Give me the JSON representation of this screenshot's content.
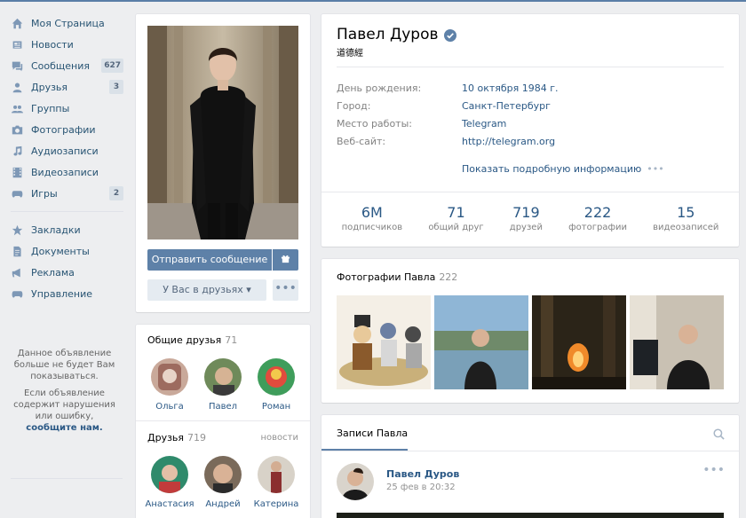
{
  "nav": {
    "items": [
      {
        "label": "Моя Страница",
        "icon": "home-icon"
      },
      {
        "label": "Новости",
        "icon": "news-icon"
      },
      {
        "label": "Сообщения",
        "icon": "messages-icon",
        "count": "627"
      },
      {
        "label": "Друзья",
        "icon": "friends-icon",
        "count": "3"
      },
      {
        "label": "Группы",
        "icon": "groups-icon"
      },
      {
        "label": "Фотографии",
        "icon": "camera-icon"
      },
      {
        "label": "Аудиозаписи",
        "icon": "music-note-icon"
      },
      {
        "label": "Видеозаписи",
        "icon": "film-icon"
      },
      {
        "label": "Игры",
        "icon": "gamepad-icon",
        "count": "2"
      }
    ],
    "extra": [
      {
        "label": "Закладки",
        "icon": "star-icon"
      },
      {
        "label": "Документы",
        "icon": "document-icon"
      },
      {
        "label": "Реклама",
        "icon": "megaphone-icon"
      },
      {
        "label": "Управление",
        "icon": "gamepad-icon"
      }
    ]
  },
  "ad_note": {
    "line1": "Данное объявление больше не будет Вам показываться.",
    "line2_prefix": "Если объявление содержит нарушения или ошибку,",
    "line2_link": "сообщите нам."
  },
  "profile": {
    "send_message": "Отправить сообщение",
    "friends_button": "У Вас в друзьях ▾",
    "more_button": "•••"
  },
  "common_friends": {
    "title": "Общие друзья",
    "count": "71",
    "items": [
      "Ольга",
      "Павел",
      "Роман"
    ]
  },
  "friends": {
    "title": "Друзья",
    "count": "719",
    "news_link": "новости",
    "items": [
      "Анастасия",
      "Андрей",
      "Катерина"
    ]
  },
  "info": {
    "name": "Павел Дуров",
    "status": "道德經",
    "rows": [
      {
        "label": "День рождения:",
        "value": "10 октября 1984 г."
      },
      {
        "label": "Город:",
        "value": "Санкт-Петербург"
      },
      {
        "label": "Место работы:",
        "value": "Telegram"
      },
      {
        "label": "Веб-сайт:",
        "value": "http://telegram.org"
      }
    ],
    "more_info": "Показать подробную информацию",
    "more_dots": "•••",
    "counters": [
      {
        "n": "6M",
        "l": "подписчиков"
      },
      {
        "n": "71",
        "l": "общий друг"
      },
      {
        "n": "719",
        "l": "друзей"
      },
      {
        "n": "222",
        "l": "фотографии"
      },
      {
        "n": "15",
        "l": "видеозаписей"
      }
    ]
  },
  "photos": {
    "title": "Фотографии Павла",
    "count": "222"
  },
  "wall": {
    "tab": "Записи Павла",
    "post": {
      "author": "Павел Дуров",
      "date": "25 фев в 20:32",
      "more": "•••"
    }
  },
  "colors": {
    "accent": "#5e81a8",
    "link": "#2a5885",
    "page_bg": "#edeef0"
  }
}
